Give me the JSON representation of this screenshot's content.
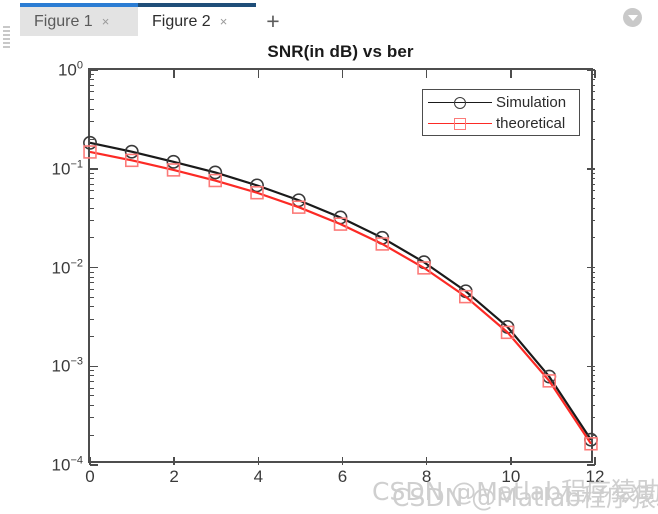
{
  "window": {
    "tabs": [
      {
        "label": "Figure 1",
        "close": "×",
        "active": false
      },
      {
        "label": "Figure 2",
        "close": "×",
        "active": true
      }
    ],
    "add_tab_label": "+",
    "menu_icon": "chevron-down-icon"
  },
  "watermark": {
    "line_a": "CSDN @Matlab程序猿助手",
    "line_b": "CSDN @Matlab程序猿助手"
  },
  "legend": {
    "items": [
      {
        "label": "Simulation",
        "color": "#1a1a1a",
        "marker": "circle"
      },
      {
        "label": "theoretical",
        "color": "#fc2a25",
        "marker": "square"
      }
    ]
  },
  "axis": {
    "y_ticks": [
      {
        "mantissa": "10",
        "exp": "0",
        "value": 1
      },
      {
        "mantissa": "10",
        "exp": "-1",
        "value": 0.1
      },
      {
        "mantissa": "10",
        "exp": "-2",
        "value": 0.01
      },
      {
        "mantissa": "10",
        "exp": "-3",
        "value": 0.001
      },
      {
        "mantissa": "10",
        "exp": "-4",
        "value": 0.0001
      }
    ],
    "x_ticks": [
      "0",
      "2",
      "4",
      "6",
      "8",
      "10",
      "12"
    ]
  },
  "chart_data": {
    "type": "line",
    "title": "SNR(in dB) vs ber",
    "xlabel": "",
    "ylabel": "",
    "yscale": "log",
    "xscale": "linear",
    "xlim": [
      0,
      12
    ],
    "ylim": [
      0.0001,
      1
    ],
    "grid": false,
    "legend_position": "upper right",
    "x": [
      0,
      1,
      2,
      3,
      4,
      5,
      6,
      7,
      8,
      9,
      10,
      11,
      12
    ],
    "series": [
      {
        "name": "Simulation",
        "color": "#1a1a1a",
        "marker": "circle",
        "values": [
          0.18,
          0.146,
          0.115,
          0.0895,
          0.066,
          0.0465,
          0.031,
          0.0192,
          0.0108,
          0.00545,
          0.00235,
          0.00073,
          0.000165
        ]
      },
      {
        "name": "theoretical",
        "color": "#fc2a25",
        "marker": "square",
        "values": [
          0.145,
          0.119,
          0.095,
          0.074,
          0.0555,
          0.0395,
          0.0265,
          0.0166,
          0.00945,
          0.0048,
          0.00207,
          0.00066,
          0.00015
        ]
      }
    ]
  }
}
